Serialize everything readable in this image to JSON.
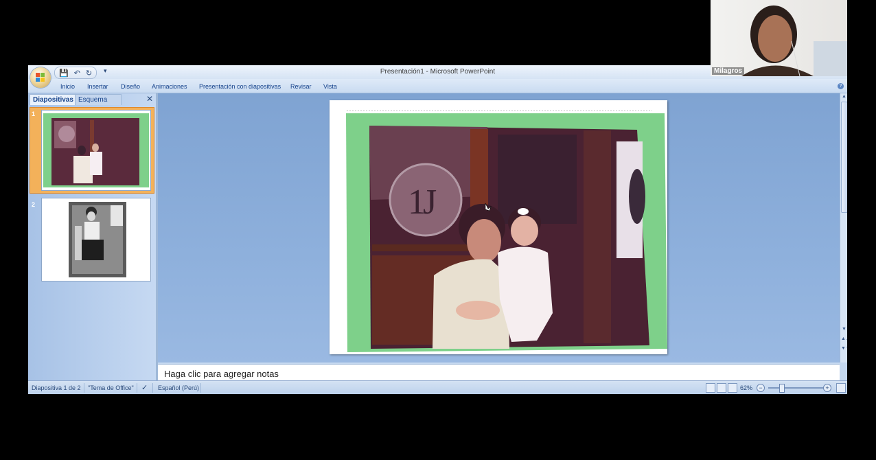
{
  "window": {
    "title": "Presentación1 - Microsoft PowerPoint"
  },
  "ribbon": {
    "tabs": [
      {
        "label": "Inicio"
      },
      {
        "label": "Insertar"
      },
      {
        "label": "Diseño"
      },
      {
        "label": "Animaciones"
      },
      {
        "label": "Presentación con diapositivas"
      },
      {
        "label": "Revisar"
      },
      {
        "label": "Vista"
      }
    ]
  },
  "side_panel": {
    "tabs": [
      {
        "label": "Diapositivas"
      },
      {
        "label": "Esquema"
      }
    ],
    "slides": [
      {
        "number": "1"
      },
      {
        "number": "2"
      }
    ]
  },
  "notes": {
    "placeholder": "Haga clic para agregar notas"
  },
  "status_bar": {
    "slide_info": "Diapositiva 1 de 2",
    "theme": "\"Tema de Office\"",
    "language": "Español (Perú)",
    "zoom": "62%"
  },
  "webcam": {
    "participant_name": "Milagros"
  },
  "colors": {
    "accent": "#15428b",
    "selected_slide": "#f3b15a",
    "photo_frame": "#7ed08a"
  }
}
